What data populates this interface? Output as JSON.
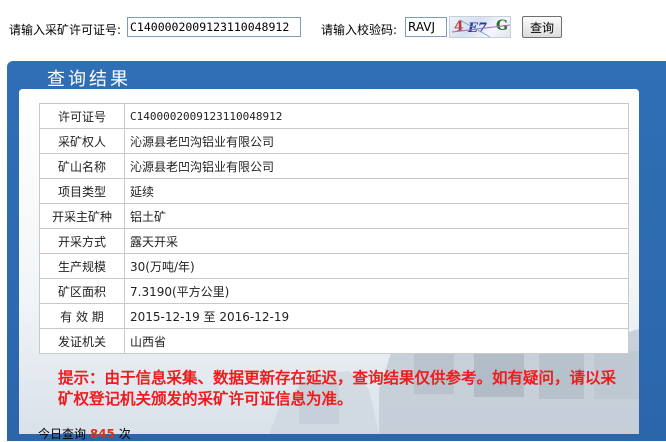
{
  "search": {
    "license_label": "请输入采矿许可证号:",
    "license_value": "C1400002009123110048912",
    "code_label": "请输入校验码:",
    "code_value": "RAVJ",
    "captcha_chars": [
      "4",
      "E7",
      "G"
    ],
    "query_button": "查询"
  },
  "panel": {
    "title": "查询结果"
  },
  "result": {
    "rows": [
      {
        "key": "许可证号",
        "value": "C1400002009123110048912"
      },
      {
        "key": "采矿权人",
        "value": "沁源县老凹沟铝业有限公司"
      },
      {
        "key": "矿山名称",
        "value": "沁源县老凹沟铝业有限公司"
      },
      {
        "key": "项目类型",
        "value": "延续"
      },
      {
        "key": "开采主矿种",
        "value": "铝土矿"
      },
      {
        "key": "开采方式",
        "value": "露天开采"
      },
      {
        "key": "生产规模",
        "value": "30(万吨/年)"
      },
      {
        "key": "矿区面积",
        "value": "7.3190(平方公里)"
      },
      {
        "key": "有 效 期",
        "value": "2015-12-19 至 2016-12-19"
      },
      {
        "key": "发证机关",
        "value": "山西省"
      }
    ]
  },
  "notice": "提示：由于信息采集、数据更新存在延迟，查询结果仅供参考。如有疑问，请以采矿权登记机关颁发的采矿许可证信息为准。",
  "footer": {
    "today_label": "今日查询",
    "today_count": "845",
    "today_unit": "次"
  },
  "colors": {
    "panel_blue": "#2f6fb5",
    "notice_red": "#ee1c1c"
  }
}
